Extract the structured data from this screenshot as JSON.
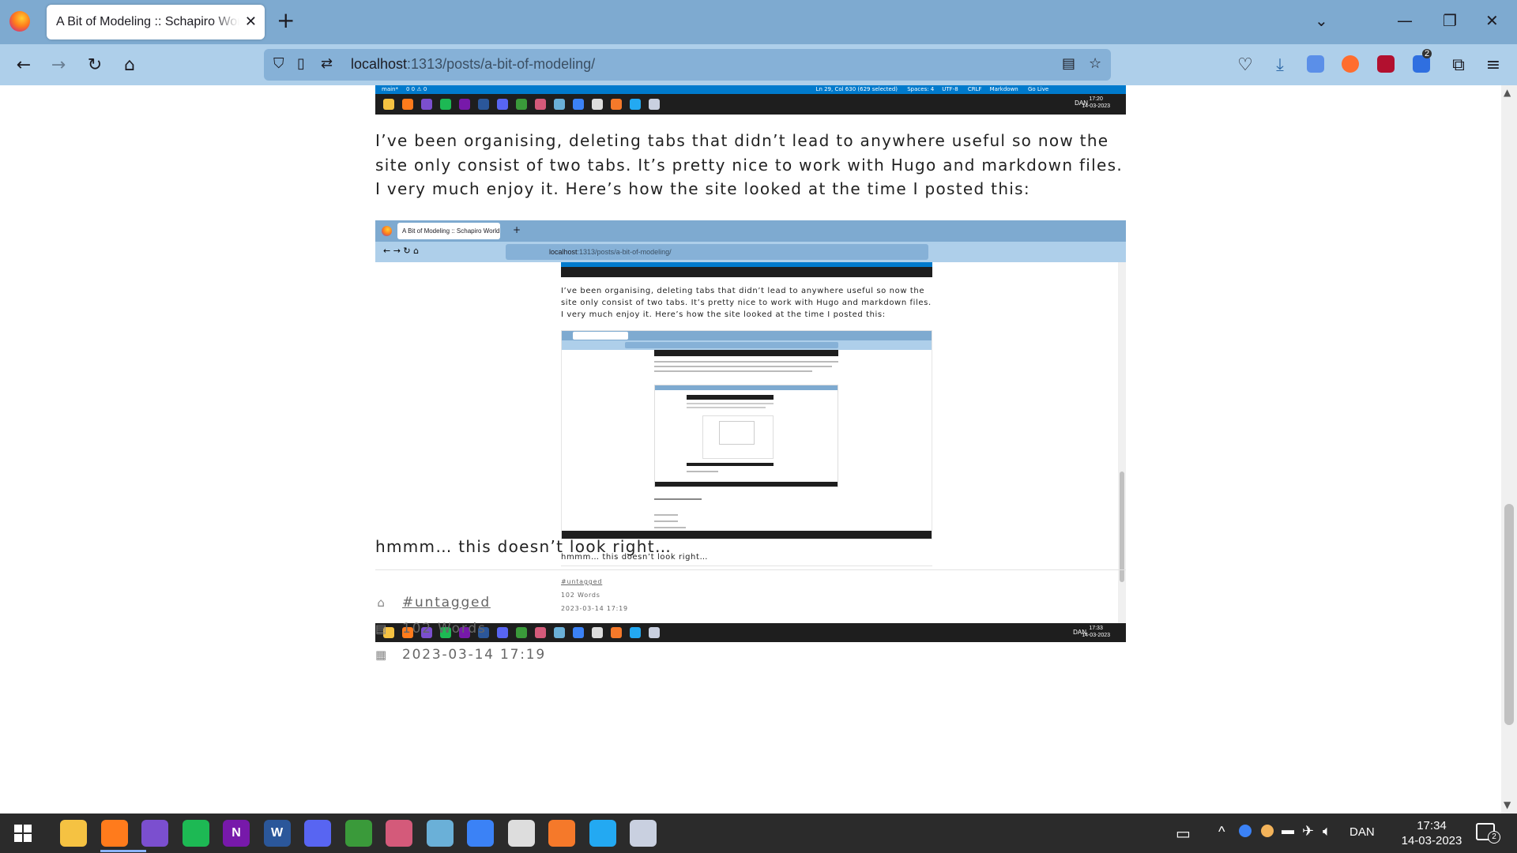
{
  "browser": {
    "tab_title": "A Bit of Modeling :: Schapiro World",
    "url_host": "localhost",
    "url_rest": ":1313/posts/a-bit-of-modeling/",
    "extension_badge": "2"
  },
  "vscode_status": {
    "branch": "main*",
    "problems": "0 0 ⚠ 0",
    "position": "Ln 29, Col 630 (629 selected)",
    "spaces": "Spaces: 4",
    "encoding": "UTF-8",
    "eol": "CRLF",
    "language": "Markdown",
    "golive": "Go Live",
    "tray_lang": "DAN",
    "tray_time": "17:20",
    "tray_date": "14-03-2023"
  },
  "article": {
    "paragraph": "I’ve been organising, deleting tabs that didn’t lead to anywhere useful so now the site only consist of two tabs. It’s pretty nice to work with Hugo and markdown files. I very much enjoy it. Here’s how the site looked at the time I posted this:",
    "after_image": "hmmm… this doesn’t look right…",
    "tag": "#untagged",
    "words": "102 Words",
    "date": "2023-03-14 17:19"
  },
  "embedded_screenshot": {
    "tab_title": "A Bit of Modeling :: Schapiro World",
    "url_host": "localhost",
    "url_rest": ":1313/posts/a-bit-of-modeling/",
    "paragraph": "I’ve been organising, deleting tabs that didn’t lead to anywhere useful so now the site only consist of two tabs. It’s pretty nice to work with Hugo and markdown files. I very much enjoy it. Here’s how the site looked at the time I posted this:",
    "after_image": "hmmm… this doesn’t look right…",
    "tag": "#untagged",
    "words": "102 Words",
    "date": "2023-03-14 17:19",
    "tray_lang": "DAN",
    "tray_time": "17:33",
    "tray_date": "14-03-2023"
  },
  "taskbar": {
    "apps": [
      {
        "name": "file-explorer",
        "color": "#f5c242"
      },
      {
        "name": "firefox",
        "color": "#ff7b1c"
      },
      {
        "name": "visual-studio",
        "color": "#7b4fcf"
      },
      {
        "name": "spotify",
        "color": "#1db954"
      },
      {
        "name": "onenote",
        "color": "#7719aa",
        "letter": "N"
      },
      {
        "name": "word",
        "color": "#2b579a",
        "letter": "W"
      },
      {
        "name": "discord",
        "color": "#5865f2"
      },
      {
        "name": "sticky-app",
        "color": "#3a9a3a"
      },
      {
        "name": "paint-app",
        "color": "#d45a7a"
      },
      {
        "name": "notes-app",
        "color": "#6ab0d8"
      },
      {
        "name": "arc-app",
        "color": "#3b82f6"
      },
      {
        "name": "unity",
        "color": "#dddddd"
      },
      {
        "name": "blender",
        "color": "#f5792a"
      },
      {
        "name": "vscode",
        "color": "#23a9f2"
      },
      {
        "name": "krita",
        "color": "#c9d0e0"
      }
    ],
    "language": "DAN",
    "time": "17:34",
    "date": "14-03-2023",
    "notification_count": "2"
  }
}
